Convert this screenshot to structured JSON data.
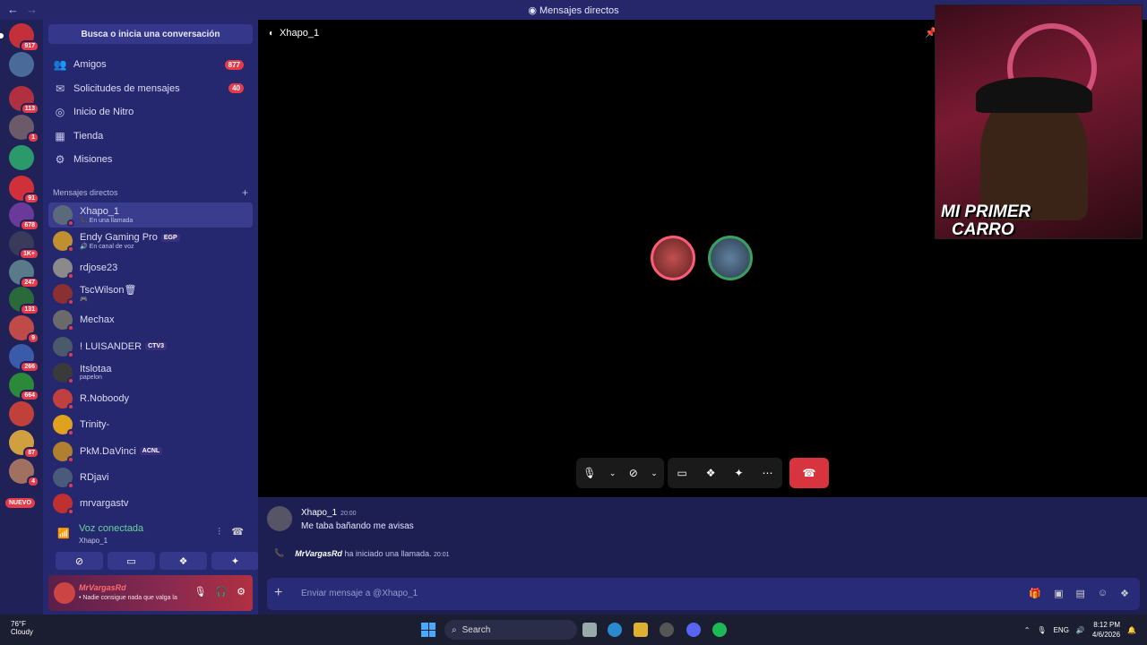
{
  "window": {
    "title": "Mensajes directos",
    "back": "←",
    "forward": "→"
  },
  "servers": [
    {
      "badge": "917",
      "color": "#c4303a"
    },
    {
      "badge": "",
      "color": "#4a6a9a"
    },
    {
      "badge": "113",
      "color": "#b03040"
    },
    {
      "badge": "1",
      "color": "#6a5a6a"
    },
    {
      "badge": "",
      "color": "#2a9a6a"
    },
    {
      "badge": "91",
      "color": "#d0303a"
    },
    {
      "badge": "678",
      "color": "#6a3a9a"
    },
    {
      "badge": "1K+",
      "color": "#3a3a5a"
    },
    {
      "badge": "247",
      "color": "#5a7a8a"
    },
    {
      "badge": "131",
      "color": "#2a6a3a"
    },
    {
      "badge": "9",
      "color": "#c04a4a"
    },
    {
      "badge": "266",
      "color": "#3a5aaa"
    },
    {
      "badge": "664",
      "color": "#2a8a3a"
    },
    {
      "badge": "",
      "color": "#c0403a"
    },
    {
      "badge": "87",
      "color": "#d0a040"
    },
    {
      "badge": "4",
      "color": "#a07060"
    }
  ],
  "new_label": "NUEVO",
  "sidebar": {
    "search_label": "Busca o inicia una conversación",
    "menu": [
      {
        "label": "Amigos",
        "icon": "👥",
        "count": "877"
      },
      {
        "label": "Solicitudes de mensajes",
        "icon": "✉",
        "count": "40"
      },
      {
        "label": "Inicio de Nitro",
        "icon": "◎",
        "count": ""
      },
      {
        "label": "Tienda",
        "icon": "▦",
        "count": ""
      },
      {
        "label": "Misiones",
        "icon": "⚙",
        "count": ""
      }
    ],
    "dm_header": "Mensajes directos",
    "dm_add": "+",
    "dms": [
      {
        "name": "Xhapo_1",
        "sub": "📞 En una llamada",
        "tag": "",
        "color": "#5a6a7a"
      },
      {
        "name": "Endy Gaming Pro",
        "sub": "🔊 En canal de voz",
        "tag": "EGP",
        "color": "#c09030"
      },
      {
        "name": "rdjose23",
        "sub": "",
        "tag": "",
        "color": "#8a8a8a"
      },
      {
        "name": "TscWilson🗑",
        "sub": "🎮",
        "tag": "",
        "color": "#8a3030"
      },
      {
        "name": "Mechax",
        "sub": "",
        "tag": "",
        "color": "#6a6a6a"
      },
      {
        "name": "! LUISANDER",
        "sub": "",
        "tag": "CTV3",
        "color": "#4a5a6a"
      },
      {
        "name": "Itslotaa",
        "sub": "papelon",
        "tag": "",
        "color": "#3a3a3a"
      },
      {
        "name": "R.Noboody",
        "sub": "",
        "tag": "",
        "color": "#c04040"
      },
      {
        "name": "Trinity-",
        "sub": "",
        "tag": "",
        "color": "#e0a020"
      },
      {
        "name": "PkM.DaVinci",
        "sub": "",
        "tag": "ACNL",
        "color": "#b08030"
      },
      {
        "name": "RDjavi",
        "sub": "",
        "tag": "",
        "color": "#4a5a7a"
      },
      {
        "name": "mrvargastv",
        "sub": "",
        "tag": "",
        "color": "#c03030"
      }
    ],
    "voice": {
      "status": "Voz conectada",
      "channel": "Xhapo_1"
    },
    "user": {
      "name": "MrVargasRd",
      "status": "• Nadie consigue nada que valga la"
    }
  },
  "call": {
    "channel": "Xhapo_1",
    "overlay_line1": "MI PRIMER",
    "overlay_line2": "CARRO"
  },
  "chat": {
    "author": "Xhapo_1",
    "time": "20:00",
    "text": "Me taba bañando me avisas",
    "sys_user": "MrVargasRd",
    "sys_text": "ha iniciado una llamada.",
    "sys_time": "20:01",
    "placeholder": "Enviar mensaje a @Xhapo_1"
  },
  "taskbar": {
    "temp": "76°F",
    "weather": "Cloudy",
    "search": "Search",
    "lang": "ENG",
    "time": "8:12 PM",
    "date": "4/6/2026"
  }
}
